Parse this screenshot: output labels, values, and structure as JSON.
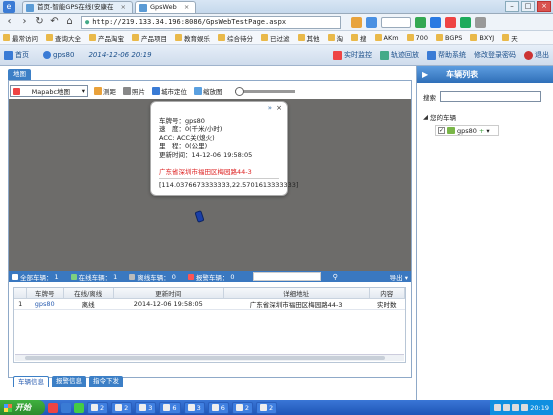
{
  "browser": {
    "tabs": [
      {
        "label": "首页-智能GPS在线(安康在",
        "active": false
      },
      {
        "label": "GpsWeb",
        "active": true
      }
    ],
    "url": "http://219.133.34.196:8086/GpsWebTestPage.aspx",
    "bookmarks": [
      "最常访问",
      "查询大全",
      "产品淘宝",
      "产品项目",
      "教育娱乐",
      "综合待分",
      "已过滤",
      "其他",
      "淘",
      "搜",
      "AKm",
      "700",
      "BGPS",
      "BXYJ",
      "天"
    ]
  },
  "header": {
    "home": "首页",
    "user": "gps80",
    "datetime": "2014-12-06 20:19",
    "right_buttons": [
      "实时监控",
      "轨迹回放",
      "帮助系统",
      "修改登录密码",
      "退出"
    ]
  },
  "map_panel": {
    "tab_label": "地图",
    "map_type": "Mapabc地图",
    "tools": [
      "测距",
      "照片",
      "城市定位",
      "缩放图"
    ],
    "zoom_level": 0.0
  },
  "popup": {
    "plate_label": "车牌号：",
    "plate_value": "gps80",
    "speed_label": "速　度：",
    "speed_value": "0(千米/小时)",
    "acc_label": "ACC:",
    "acc_value": "ACC关(熄火)",
    "mileage_label": "里　程：",
    "mileage_value": "0(公里)",
    "time_label": "更新时间：",
    "time_value": "14-12-06 19:58:05",
    "address": "广东省深圳市福田区梅园路44-3",
    "coords": "[114.0376673333333,22.5701613333333]"
  },
  "status_bar": {
    "all_label": "全部车辆：",
    "all_count": "1",
    "online_label": "在线车辆：",
    "online_count": "1",
    "offline_label": "离线车辆：",
    "offline_count": "0",
    "alarm_label": "报警车辆：",
    "alarm_count": "0",
    "export_label": "导出"
  },
  "table": {
    "headers": [
      "",
      "车牌号",
      "在线/离线",
      "更新时间",
      "详细地址",
      "内容"
    ],
    "rows": [
      [
        "1",
        "gps80",
        "离线",
        "2014-12-06 19:58:05",
        "广东省深圳市福田区梅园路44-3",
        "实时数"
      ]
    ]
  },
  "bottom_tabs": [
    "车辆信息",
    "报警信息",
    "指令下发"
  ],
  "right_panel": {
    "title": "车辆列表",
    "search_label": "搜索",
    "tree_root": "您的车辆",
    "vehicle": "gps80"
  },
  "taskbar": {
    "start": "开始",
    "items": [
      "2",
      "2",
      "3",
      "6",
      "3",
      "6",
      "2",
      "2"
    ],
    "clock": "20:19"
  },
  "colors": {
    "accent": "#3c7fc6",
    "map_bg": "#6d6c6a",
    "address_red": "#d22222",
    "taskbar": "#1e55b7"
  }
}
